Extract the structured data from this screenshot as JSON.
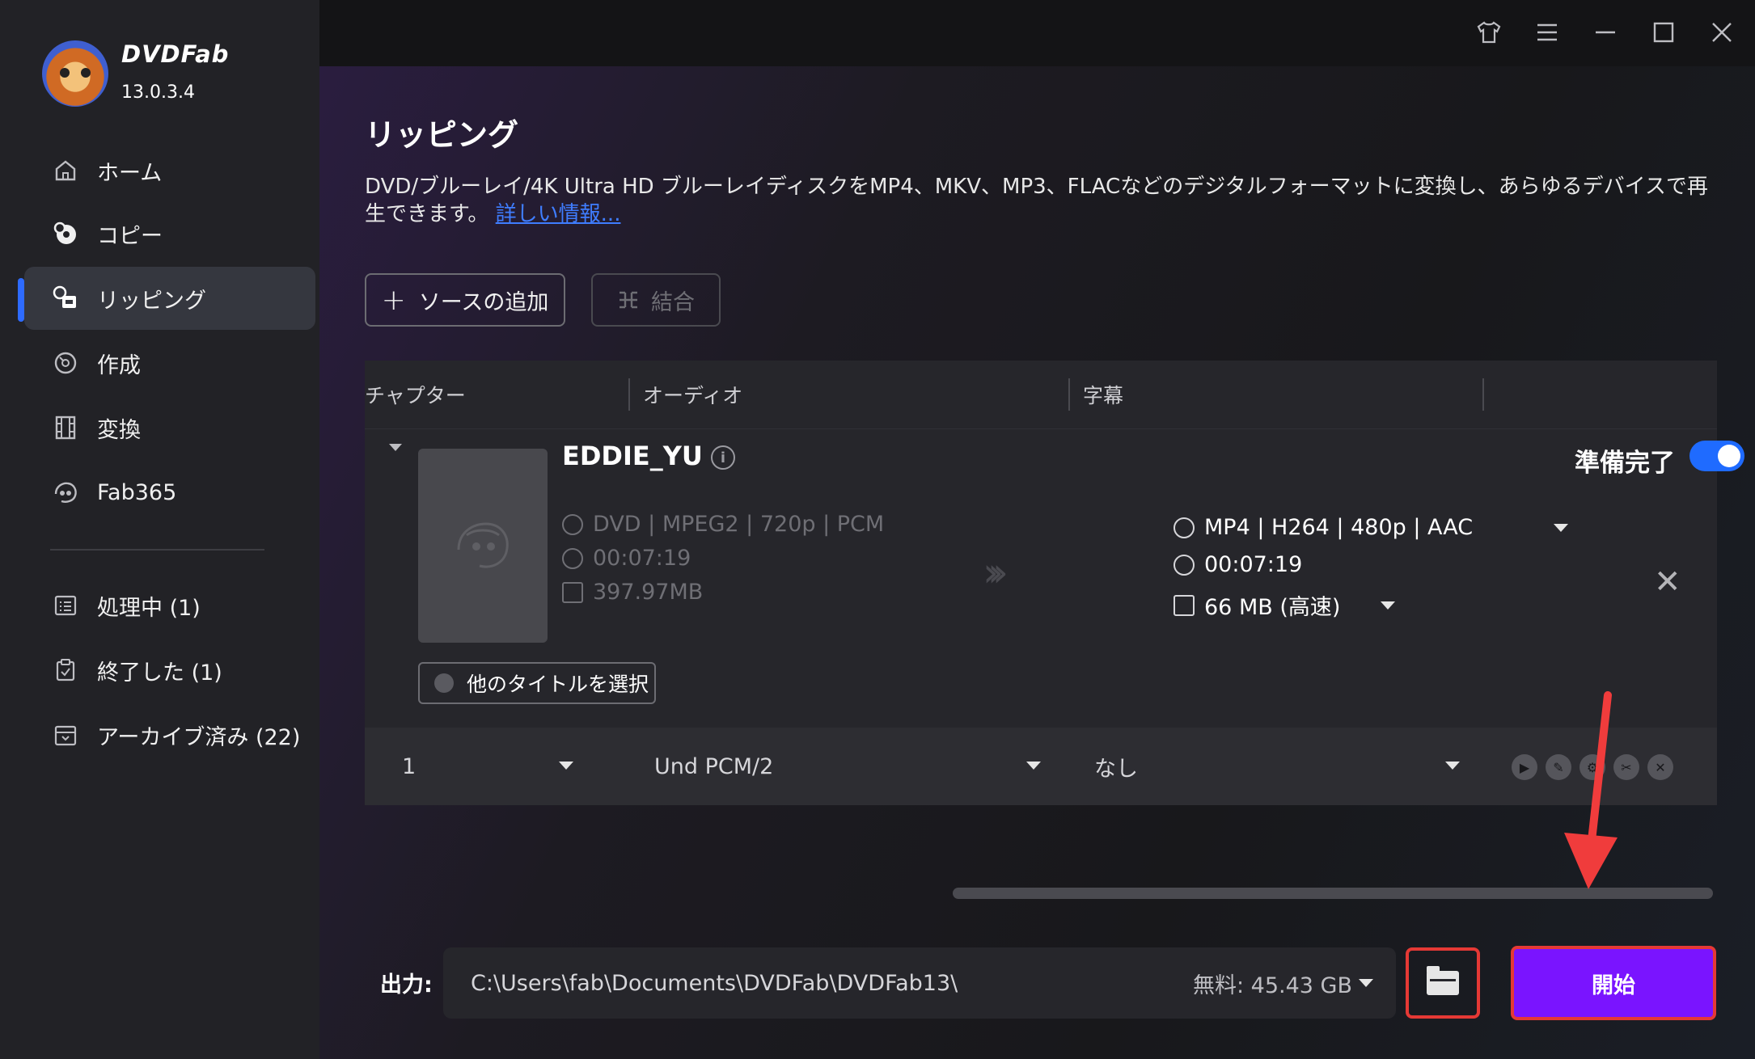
{
  "app": {
    "brand": "DVDFab",
    "version": "13.0.3.4"
  },
  "sidebar": {
    "items": [
      {
        "label": "ホーム",
        "icon": "home-icon"
      },
      {
        "label": "コピー",
        "icon": "copy-disc-icon"
      },
      {
        "label": "リッピング",
        "icon": "ripper-icon",
        "active": true
      },
      {
        "label": "作成",
        "icon": "creator-icon"
      },
      {
        "label": "変換",
        "icon": "film-icon"
      },
      {
        "label": "Fab365",
        "icon": "fab365-icon"
      }
    ],
    "queue": [
      {
        "label": "処理中 (1)",
        "icon": "processing-list-icon"
      },
      {
        "label": "終了した (1)",
        "icon": "finished-clipboard-icon"
      },
      {
        "label": "アーカイブ済み (22)",
        "icon": "archive-box-icon"
      }
    ]
  },
  "page": {
    "title": "リッピング",
    "description": "DVD/ブルーレイ/4K Ultra HD ブルーレイディスクをMP4、MKV、MP3、FLACなどのデジタルフォーマットに変換し、あらゆるデバイスで再生できます。",
    "more_link": "詳しい情報..."
  },
  "toolbar": {
    "add_source": "ソースの追加",
    "merge": "結合"
  },
  "table": {
    "headers": {
      "chapter": "チャプター",
      "audio": "オーディオ",
      "subtitle": "字幕"
    }
  },
  "item": {
    "title": "EDDIE_YU",
    "ready_label": "準備完了",
    "ready": true,
    "source": {
      "format": "DVD | MPEG2 | 720p | PCM",
      "duration": "00:07:19",
      "size": "397.97MB"
    },
    "output": {
      "format": "MP4 | H264 | 480p | AAC",
      "duration": "00:07:19",
      "size": "66 MB (高速)"
    },
    "select_other": "他のタイトルを選択"
  },
  "chapter_row": {
    "chapter": "1",
    "audio": "Und  PCM/2",
    "subtitle": "なし"
  },
  "output_bar": {
    "label": "出力:",
    "path": "C:\\Users\\fab\\Documents\\DVDFab\\DVDFab13\\",
    "free": "無料: 45.43 GB",
    "start": "開始"
  },
  "colors": {
    "accent": "#1f6bff",
    "start_button": "#7a14ff",
    "highlight": "#e53935"
  }
}
